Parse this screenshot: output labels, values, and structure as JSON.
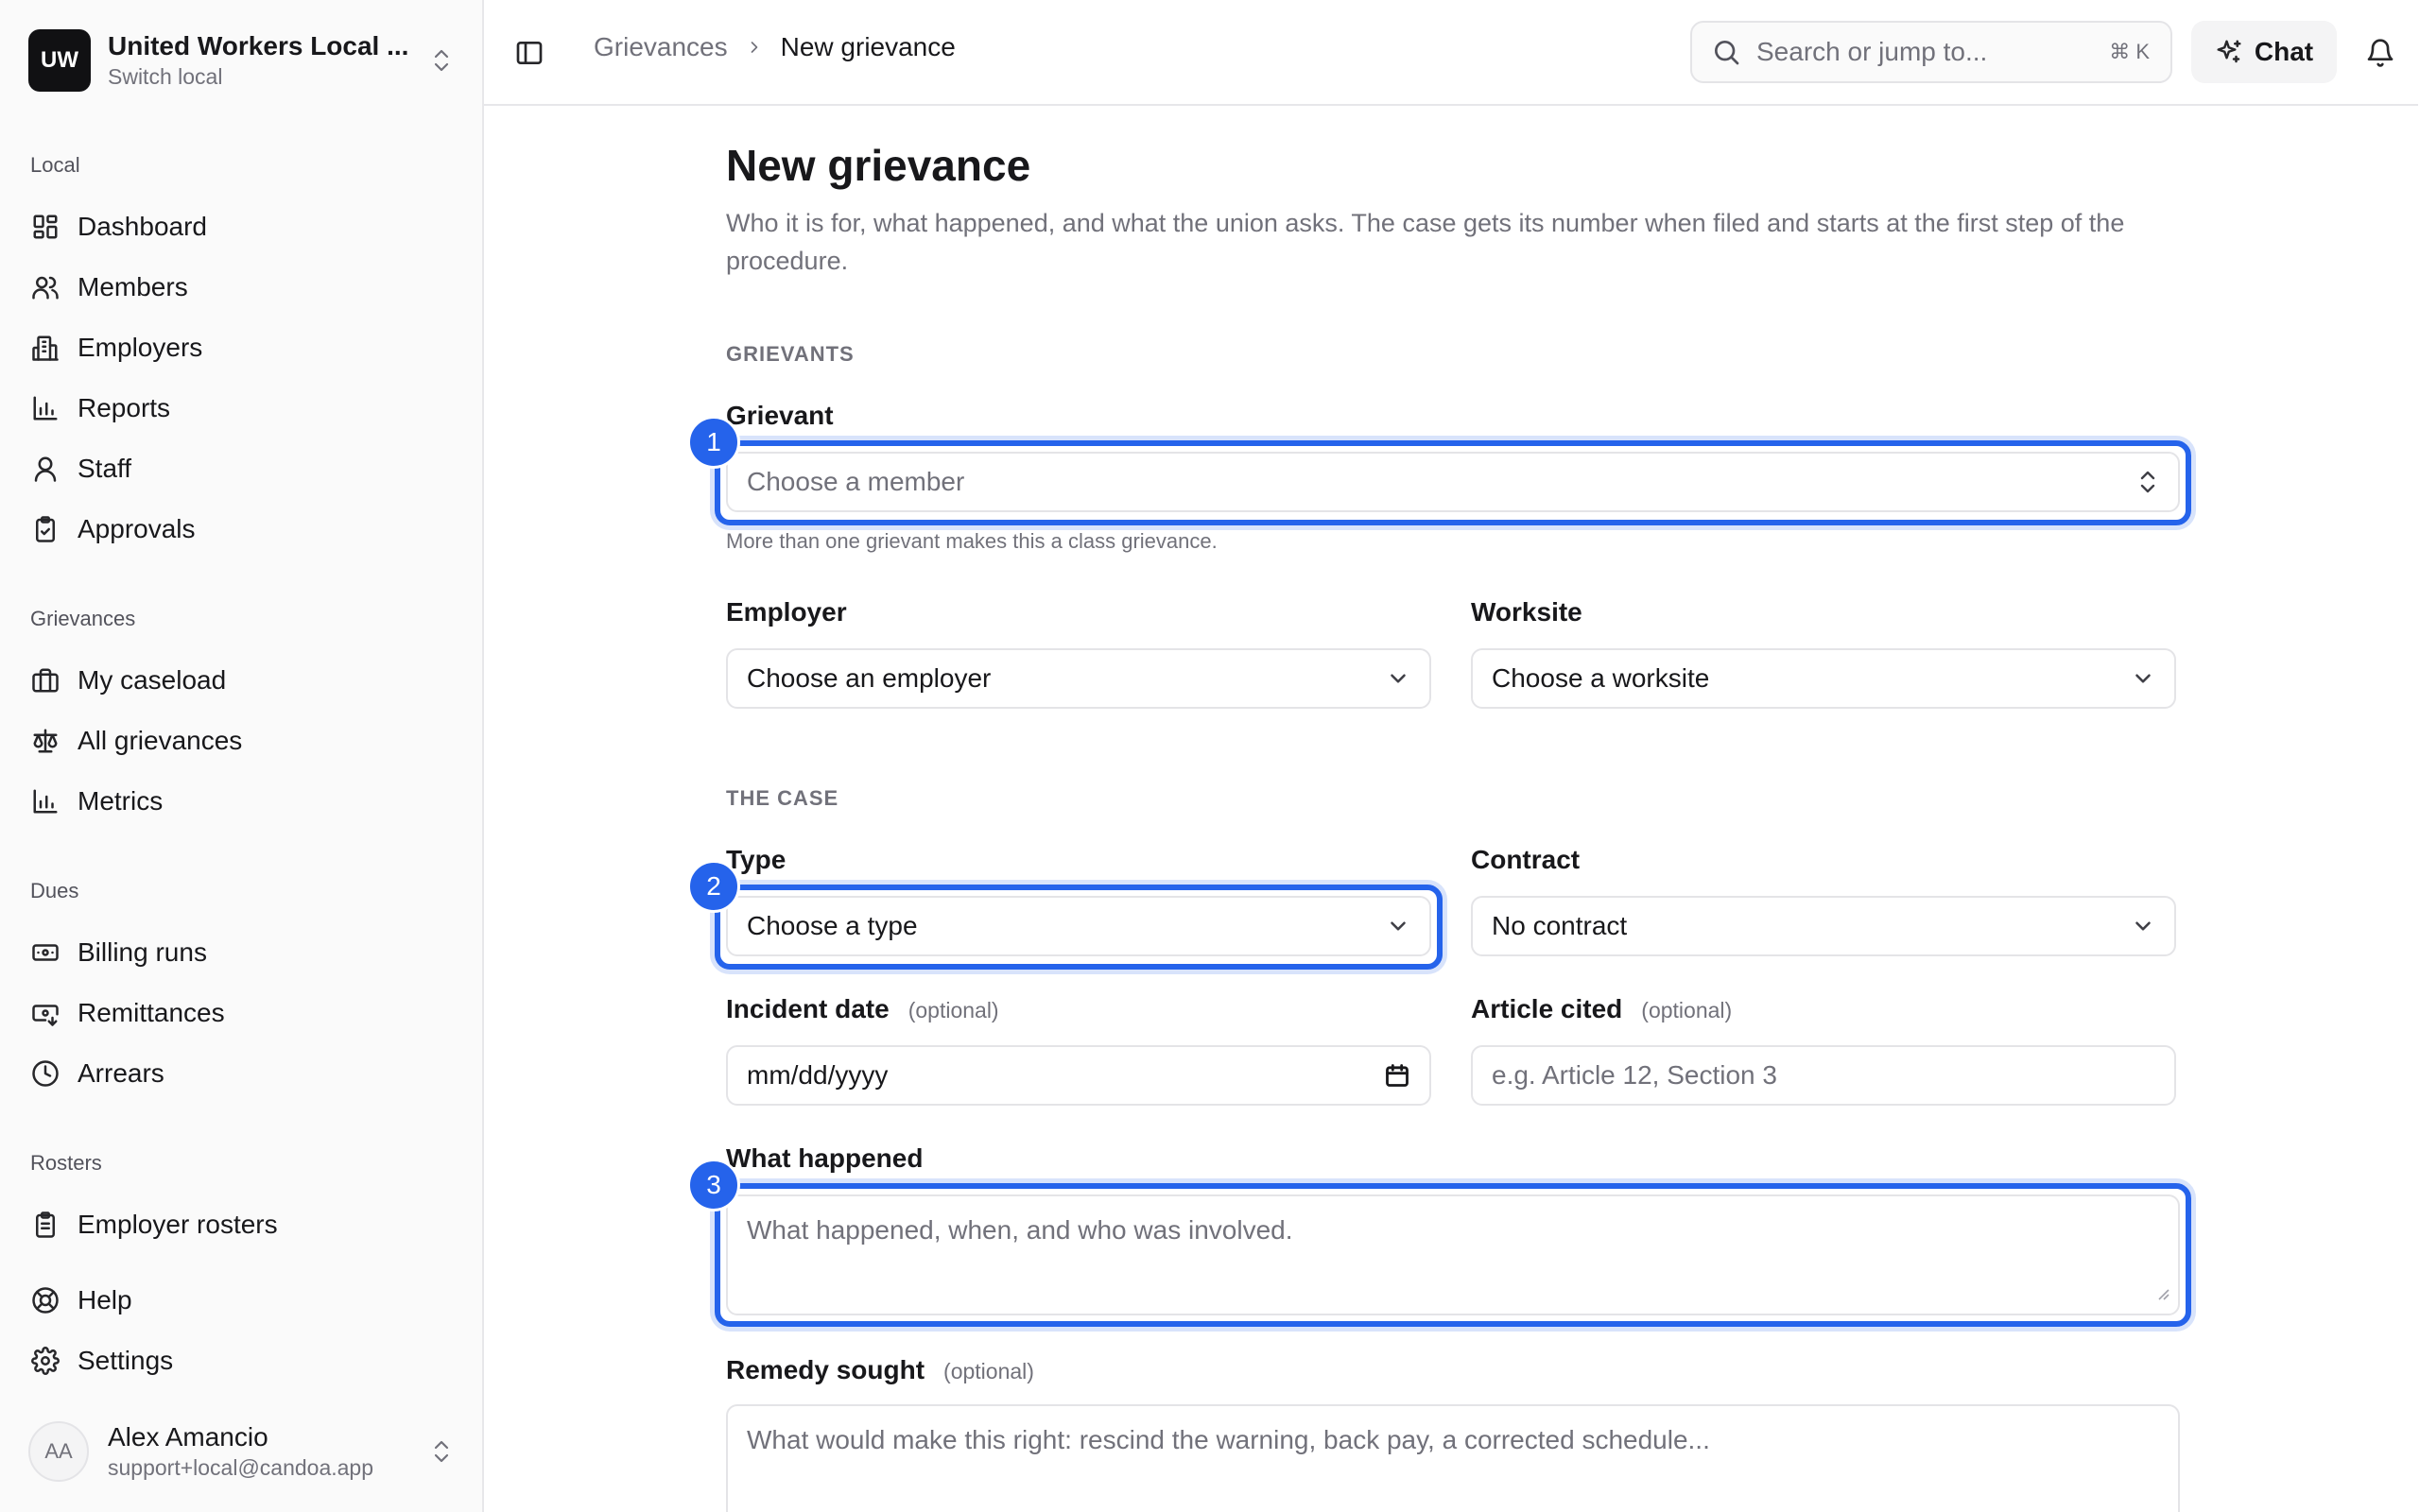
{
  "org": {
    "initials": "UW",
    "name": "United Workers Local ...",
    "subtitle": "Switch local"
  },
  "sidebar": {
    "sections": {
      "local": "Local",
      "grievances": "Grievances",
      "dues": "Dues",
      "rosters": "Rosters"
    },
    "items": {
      "dashboard": "Dashboard",
      "members": "Members",
      "employers": "Employers",
      "reports": "Reports",
      "staff": "Staff",
      "approvals": "Approvals",
      "my_caseload": "My caseload",
      "all_grievances": "All grievances",
      "metrics": "Metrics",
      "billing_runs": "Billing runs",
      "remittances": "Remittances",
      "arrears": "Arrears",
      "employer_rosters": "Employer rosters",
      "help": "Help",
      "settings": "Settings"
    }
  },
  "user": {
    "initials": "AA",
    "name": "Alex Amancio",
    "email": "support+local@candoa.app"
  },
  "topbar": {
    "breadcrumb_parent": "Grievances",
    "breadcrumb_current": "New grievance",
    "search_placeholder": "Search or jump to...",
    "search_shortcut": "⌘  K",
    "chat_label": "Chat"
  },
  "form": {
    "title": "New grievance",
    "description": "Who it is for, what happened, and what the union asks. The case gets its number when filed and starts at the first step of the procedure.",
    "section_grievants": "GRIEVANTS",
    "grievant_label": "Grievant",
    "grievant_placeholder": "Choose a member",
    "grievant_hint": "More than one grievant makes this a class grievance.",
    "employer_label": "Employer",
    "employer_value": "Choose an employer",
    "worksite_label": "Worksite",
    "worksite_value": "Choose a worksite",
    "section_case": "THE CASE",
    "type_label": "Type",
    "type_value": "Choose a type",
    "contract_label": "Contract",
    "contract_value": "No contract",
    "incident_label": "Incident date",
    "incident_value": "mm/dd/yyyy",
    "article_label": "Article cited",
    "article_placeholder": "e.g. Article 12, Section 3",
    "optional": "(optional)",
    "what_label": "What happened",
    "what_placeholder": "What happened, when, and who was involved.",
    "remedy_label": "Remedy sought",
    "remedy_placeholder": "What would make this right: rescind the warning, back pay, a corrected schedule..."
  },
  "annotations": {
    "one": "1",
    "two": "2",
    "three": "3"
  },
  "colors": {
    "accent": "#2563eb",
    "sidebar_bg": "#fafafa"
  }
}
